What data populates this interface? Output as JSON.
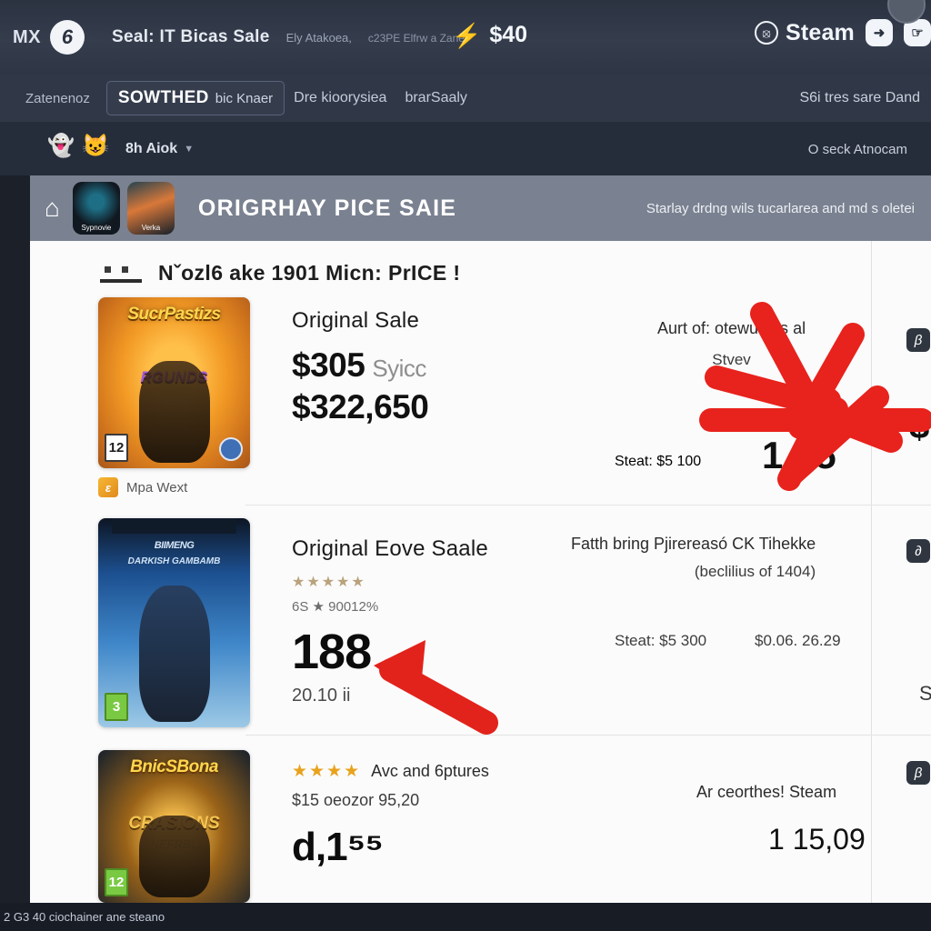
{
  "titlebar": {
    "app_mark": "MX",
    "logo_glyph": "6",
    "crumb_main": "Seal: IT Bicas Sale",
    "crumb_sub": "Ely Atakoea,",
    "crumb_extra": "c23PE Elfrw a Zane",
    "center_icon": "bolt-icon",
    "center_amount": "$40",
    "steam_label": "Steam",
    "steam_icon": "steam-logo-icon",
    "action_1_icon": "cursor-icon",
    "action_2_icon": "pointer-icon"
  },
  "navbar": {
    "back_label": "Zatenenoz",
    "active_tab_strong": "SOWTHED",
    "active_tab_weak": "bic Knaer",
    "tabs": [
      {
        "label": "Dre kioorysiea"
      },
      {
        "label": "brarSaaly"
      }
    ],
    "right_label": "S6i tres sare Dand"
  },
  "substrip": {
    "icon_1": "ghost-icon",
    "icon_2": "cat-icon",
    "label": "8h Aiok",
    "caret": "chevron-down-icon",
    "right_label": "O seck Atnocam"
  },
  "banner": {
    "icon": "home-icon",
    "thumb_1_label": "Sypnovie",
    "thumb_2_label": "Verka",
    "title": "ORIGRHAY PICE SAIE",
    "note": "Starlay drdng wils tucarlarea and md s oletei"
  },
  "list_header": {
    "mark": "list-mark-icon",
    "text": "Nˇozl6 ake 1901 Micn: PrICE !"
  },
  "rows": [
    {
      "cover_title": "SucrPastizs",
      "cover_subtitle": "RGUNDS",
      "age_rating": "12",
      "store_chip": "epic-icon",
      "store_name": "Mpa Wext",
      "mid_title": "Original Sale",
      "price_main": "$305",
      "price_muted": "Syicc",
      "price_second": "$322,650",
      "right_note": "Aurt of: otewu. Iss al",
      "right_note_2": "Stvev",
      "right_small": "Steat: $5 100",
      "right_big": "1 05",
      "edge_badge": "badge-icon",
      "edge_symbol": "$"
    },
    {
      "cover_title": "BIIMENG",
      "cover_subtitle": "DARKISH GAMBAMB",
      "age_rating": "3",
      "mid_title": "Original Eove Saale",
      "stars": "★★★★★",
      "rating_line": "6S ★ 90012%",
      "huge": "188",
      "sub_small": "20.10 ii",
      "right_note": "Fatth bring Pjirereasó CK Tihekke",
      "right_note_2": "(beclilius of 1404)",
      "right_small": "Steat: $5 300",
      "right_price": "$0.06. 26.29",
      "edge_badge": "badge-icon",
      "edge_s": "S"
    },
    {
      "cover_title": "BnicSBona",
      "cover_subtitle": "CRASIONS",
      "cover_subtitle_2": "ONEFRBLK",
      "age_rating": "12",
      "stars": "★★★★",
      "stars_label": "Avc and 6ptures",
      "rating_line": "$15 oeozor 95,20",
      "huge": "d,1⁵⁵",
      "right_note": "Ar ceorthes! Steam",
      "right_big": "1 15,09",
      "edge_badge": "badge-icon"
    }
  ],
  "annotations": {
    "starburst_color": "#e8221c",
    "arrow_color": "#e2231b"
  },
  "footer": {
    "text": "2 G3 40 ciochainer ane steano"
  }
}
